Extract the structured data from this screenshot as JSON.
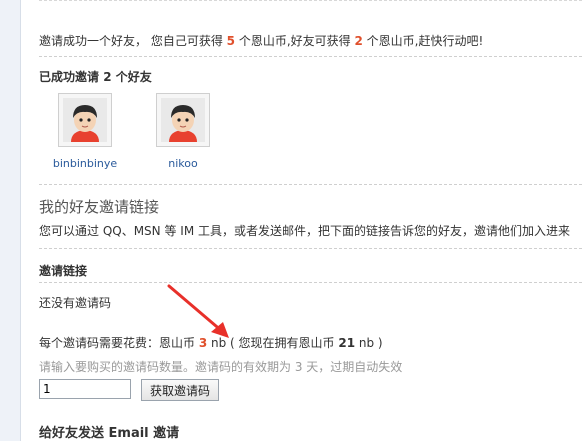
{
  "invite_banner": {
    "text_before": "邀请成功一个好友， 您自己可获得 ",
    "self_reward": "5",
    "text_middle": " 个恩山币,好友可获得 ",
    "friend_reward": "2",
    "text_after": " 个恩山币,赶快行动吧!"
  },
  "success": {
    "title_prefix": "已成功邀请 ",
    "count": "2",
    "title_suffix": " 个好友"
  },
  "friends": [
    {
      "name": "binbinbinye"
    },
    {
      "name": "nikoo"
    }
  ],
  "invite_link_section": {
    "title": "我的好友邀请链接",
    "description": "您可以通过 QQ、MSN 等 IM 工具，或者发送邮件，把下面的链接告诉您的好友，邀请他们加入进来"
  },
  "invite_code": {
    "title": "邀请链接",
    "empty_text": "还没有邀请码",
    "cost_prefix": "每个邀请码需要花费：恩山币 ",
    "cost_value": "3",
    "cost_middle": " nb ( 您现在拥有恩山币 ",
    "owned_value": "21",
    "cost_suffix": " nb )",
    "hint": "请输入要购买的邀请码数量。邀请码的有效期为 3 天，过期自动失效",
    "quantity_value": "1",
    "button_label": "获取邀请码"
  },
  "email_section": {
    "title": "给好友发送 Email 邀请"
  },
  "colors": {
    "accent_number": "#e0502c",
    "link_blue": "#2a5a9b",
    "annotation_arrow": "#e8302a"
  }
}
